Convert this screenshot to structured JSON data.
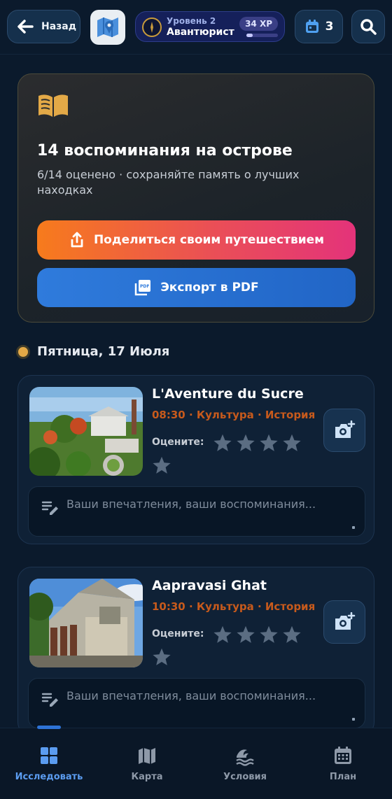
{
  "header": {
    "back_label": "Назад",
    "level_label": "Уровень 2",
    "rank_label": "Авантюрист",
    "xp_label": "34 XP",
    "xp_progress": 0.2,
    "calendar_count": "3"
  },
  "summary": {
    "title": "14 воспоминания на острове",
    "subtitle": "6/14 оценено · сохраняйте память о лучших находках",
    "share_label": "Поделиться своим путешествием",
    "pdf_label": "Экспорт в PDF"
  },
  "day": {
    "title": "Пятница, 17 Июля"
  },
  "cards": [
    {
      "title": "L'Aventure du Sucre",
      "meta": "08:30 · Культура · История",
      "rate_label": "Оцените:",
      "note_placeholder": "Ваши впечатления, ваши воспоминания..."
    },
    {
      "title": "Aapravasi Ghat",
      "meta": "10:30 · Культура · История",
      "rate_label": "Оцените:",
      "note_placeholder": "Ваши впечатления, ваши воспоминания..."
    }
  ],
  "nav": {
    "explore": "Исследовать",
    "map": "Карта",
    "conditions": "Условия",
    "plan": "План"
  },
  "colors": {
    "accent_orange": "#c75a1c",
    "accent_blue": "#5b9cf0",
    "star_gray": "#5b6d82"
  }
}
